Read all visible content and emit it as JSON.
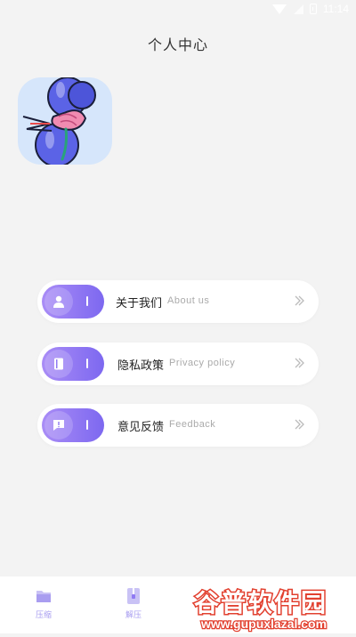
{
  "status_bar": {
    "time": "11:14"
  },
  "header": {
    "title": "个人中心"
  },
  "menu": [
    {
      "label": "关于我们",
      "sublabel": "About us"
    },
    {
      "label": "隐私政策",
      "sublabel": "Privacy policy"
    },
    {
      "label": "意见反馈",
      "sublabel": "Feedback"
    }
  ],
  "bottom_nav": [
    {
      "label": "压缩"
    },
    {
      "label": "解压"
    }
  ],
  "watermark": {
    "title": "谷普软件园",
    "url": "www.gupuxlazal.com"
  },
  "colors": {
    "accent_start": "#a98cf6",
    "accent_end": "#7d68f0",
    "background": "#f3f3f3"
  },
  "icons": [
    "wifi-icon",
    "signal-icon",
    "battery-icon",
    "user-icon",
    "book-icon",
    "message-icon",
    "chevron-right-icon",
    "folder-icon",
    "zip-file-icon"
  ]
}
